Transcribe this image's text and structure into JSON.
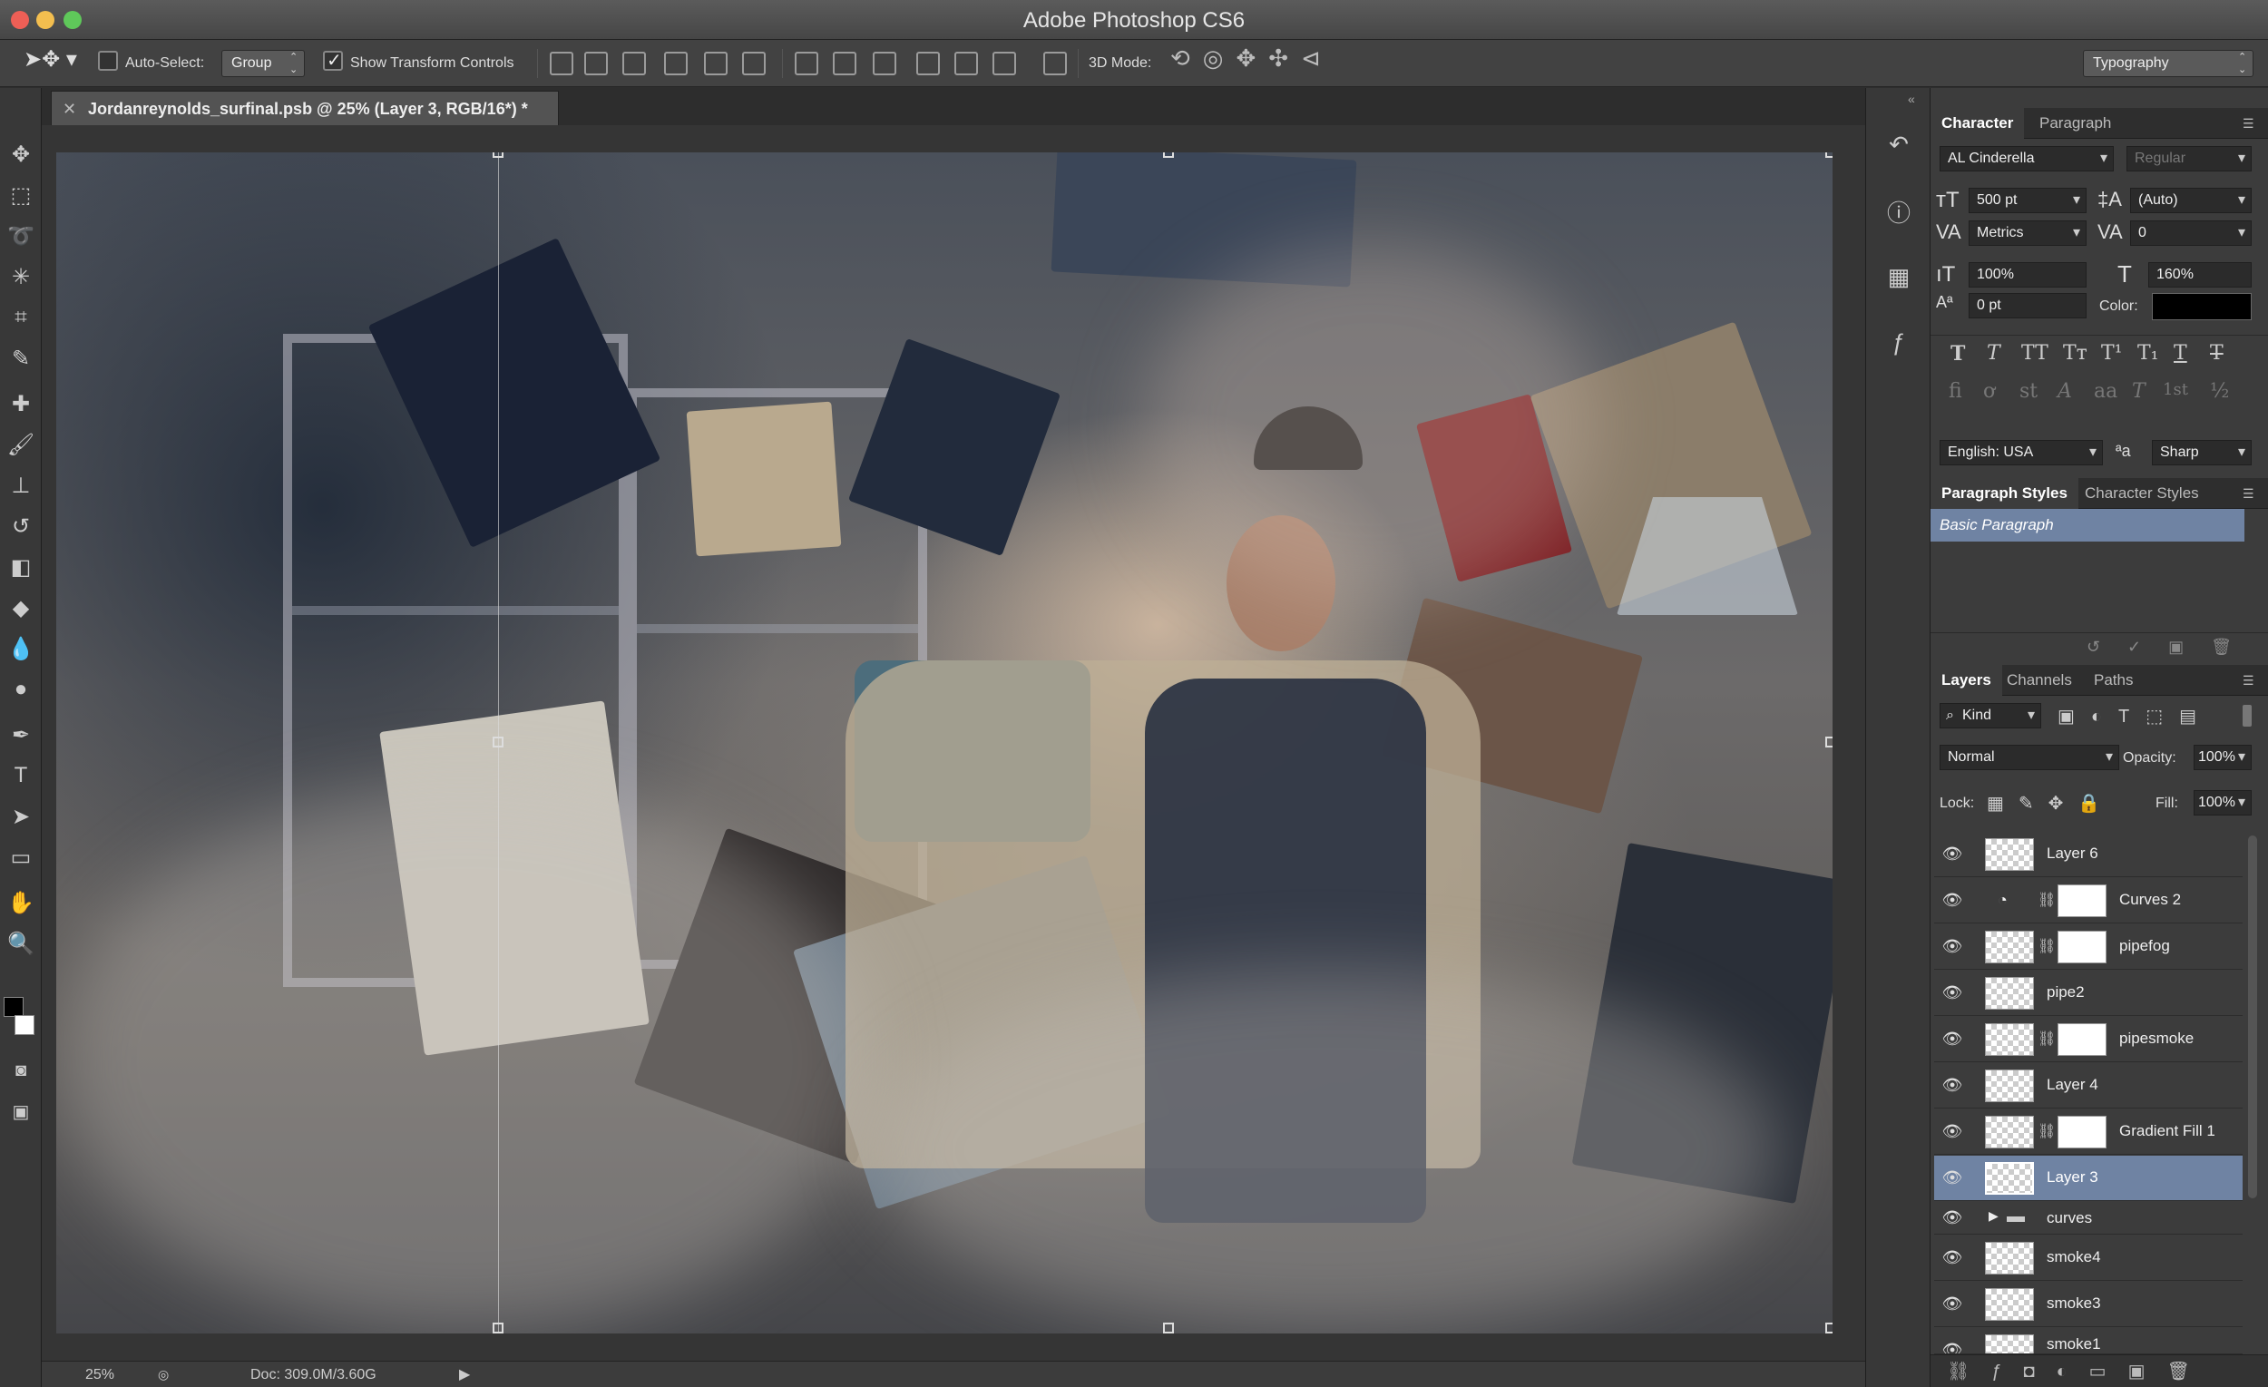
{
  "window": {
    "title": "Adobe Photoshop CS6"
  },
  "options_bar": {
    "auto_select_label": "Auto-Select:",
    "auto_select_checked": false,
    "auto_select_target": "Group",
    "show_transform_label": "Show Transform Controls",
    "show_transform_checked": true,
    "mode_3d_label": "3D Mode:",
    "workspace": "Typography"
  },
  "document": {
    "tab_title": "Jordanreynolds_surfinal.psb @ 25% (Layer 3, RGB/16*) *",
    "zoom": "25%",
    "doc_size": "Doc: 309.0M/3.60G"
  },
  "character_panel": {
    "tabs": [
      "Character",
      "Paragraph"
    ],
    "font_family": "AL Cinderella",
    "font_style": "Regular",
    "font_size": "500 pt",
    "leading": "(Auto)",
    "kerning": "Metrics",
    "tracking": "0",
    "vertical_scale": "100%",
    "horizontal_scale": "160%",
    "baseline_shift": "0 pt",
    "color_label": "Color:",
    "color": "#000000",
    "language": "English: USA",
    "aa_label": "ªa",
    "antialias": "Sharp",
    "type_buttons": [
      "T",
      "T",
      "TT",
      "Tт",
      "T¹",
      "T₁",
      "T",
      "T"
    ],
    "ot_buttons": [
      "fi",
      "ơ",
      "st",
      "A",
      "aa",
      "T",
      "1st",
      "½"
    ]
  },
  "paragraph_styles_panel": {
    "tabs": [
      "Paragraph Styles",
      "Character Styles"
    ],
    "items": [
      "Basic Paragraph"
    ]
  },
  "layers_panel": {
    "tabs": [
      "Layers",
      "Channels",
      "Paths"
    ],
    "filter_kind": "Kind",
    "blend_mode": "Normal",
    "opacity_label": "Opacity:",
    "opacity": "100%",
    "lock_label": "Lock:",
    "fill_label": "Fill:",
    "fill": "100%",
    "layers": [
      {
        "name": "Layer 6",
        "type": "pixel"
      },
      {
        "name": "Curves 2",
        "type": "adjustment"
      },
      {
        "name": "pipefog",
        "type": "masked"
      },
      {
        "name": "pipe2",
        "type": "pixel"
      },
      {
        "name": "pipesmoke",
        "type": "masked"
      },
      {
        "name": "Layer 4",
        "type": "pixel"
      },
      {
        "name": "Gradient Fill 1",
        "type": "masked"
      },
      {
        "name": "Layer 3",
        "type": "pixel",
        "selected": true
      },
      {
        "name": "curves",
        "type": "group"
      },
      {
        "name": "smoke4",
        "type": "pixel"
      },
      {
        "name": "smoke3",
        "type": "pixel"
      },
      {
        "name": "smoke1",
        "type": "pixel"
      }
    ]
  },
  "colors": {
    "selection": "#6f83a3",
    "foreground": "#000000",
    "background": "#ffffff"
  }
}
